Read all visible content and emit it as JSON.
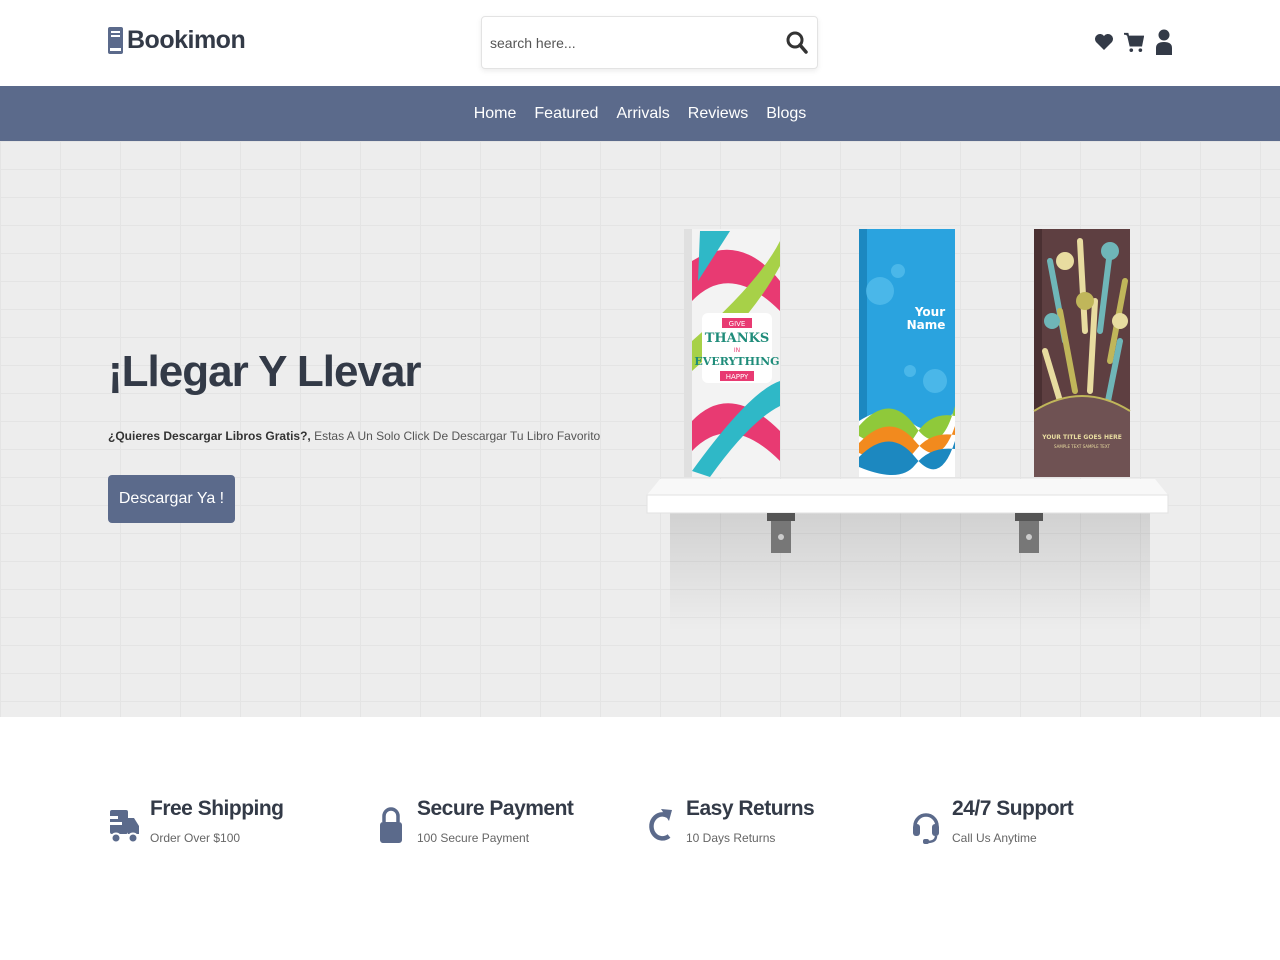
{
  "brand": {
    "name": "Bookimon"
  },
  "search": {
    "placeholder": "search here..."
  },
  "nav": {
    "items": [
      "Home",
      "Featured",
      "Arrivals",
      "Reviews",
      "Blogs"
    ]
  },
  "hero": {
    "title": "¡Llegar Y Llevar",
    "subtitle_bold": "¿Quieres Descargar Libros Gratis?,",
    "subtitle_rest": " Estas A Un Solo Click De Descargar Tu Libro Favorito",
    "button": "Descargar Ya !",
    "books": [
      {
        "line1": "GIVE",
        "line2": "THANKS",
        "line3": "IN",
        "line4": "EVERYTHING",
        "line5": "HAPPY"
      },
      {
        "line1": "Your",
        "line2": "Name"
      },
      {
        "line1": "YOUR TITLE GOES HERE",
        "line2": "SAMPLE TEXT SAMPLE TEXT"
      }
    ]
  },
  "features": [
    {
      "title": "Free Shipping",
      "desc": "Order Over $100",
      "icon": "truck-icon"
    },
    {
      "title": "Secure Payment",
      "desc": "100 Secure Payment",
      "icon": "lock-icon"
    },
    {
      "title": "Easy Returns",
      "desc": "10 Days Returns",
      "icon": "redo-icon"
    },
    {
      "title": "24/7 Support",
      "desc": "Call Us Anytime",
      "icon": "headset-icon"
    }
  ],
  "colors": {
    "primary": "#5b6a8b",
    "dark": "#333a47",
    "hero_bg": "#ededed"
  }
}
